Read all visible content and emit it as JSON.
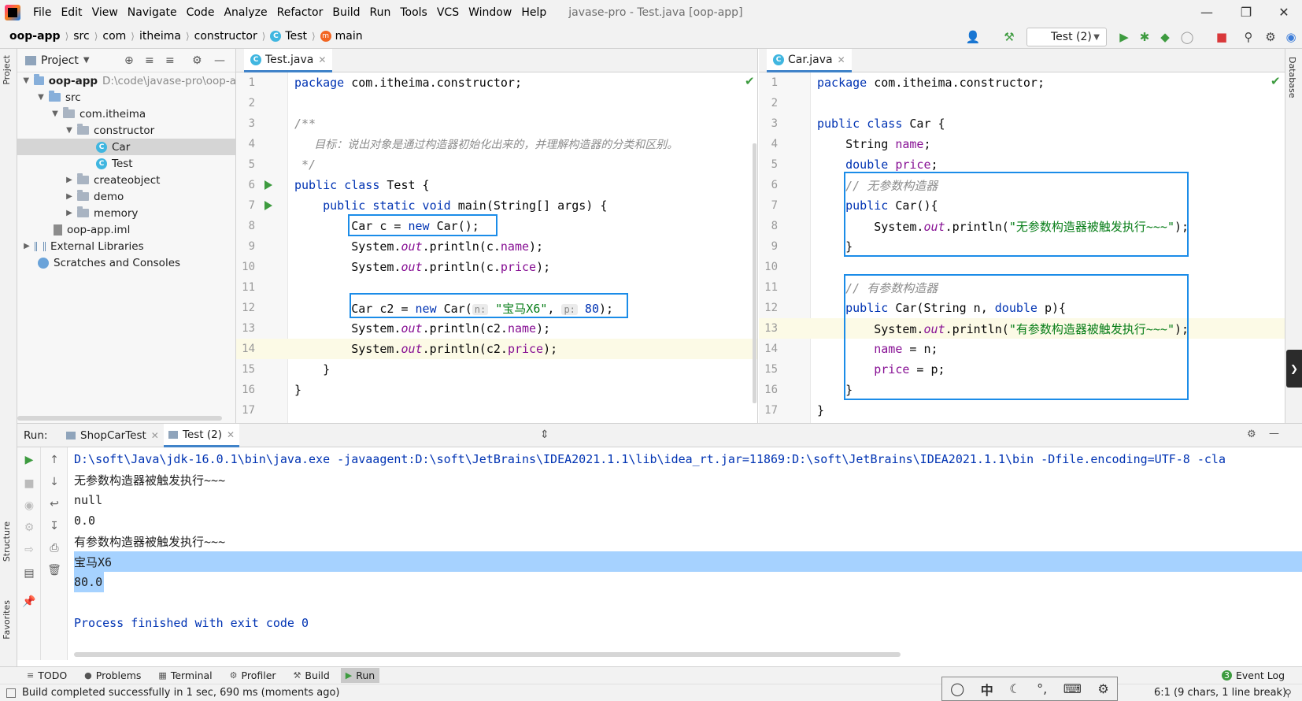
{
  "menubar": {
    "items": [
      "File",
      "Edit",
      "View",
      "Navigate",
      "Code",
      "Analyze",
      "Refactor",
      "Build",
      "Run",
      "Tools",
      "VCS",
      "Window",
      "Help"
    ],
    "window_title": "javase-pro - Test.java [oop-app]"
  },
  "navbar": {
    "crumbs": [
      "oop-app",
      "src",
      "com",
      "itheima",
      "constructor",
      "Test",
      "main"
    ],
    "run_config": "Test (2)"
  },
  "project": {
    "header": "Project",
    "tree": [
      {
        "label": "oop-app",
        "hint": "D:\\code\\javase-pro\\oop-a"
      },
      {
        "label": "src"
      },
      {
        "label": "com.itheima"
      },
      {
        "label": "constructor"
      },
      {
        "label": "Car"
      },
      {
        "label": "Test"
      },
      {
        "label": "createobject"
      },
      {
        "label": "demo"
      },
      {
        "label": "memory"
      },
      {
        "label": "oop-app.iml"
      },
      {
        "label": "External Libraries"
      },
      {
        "label": "Scratches and Consoles"
      }
    ]
  },
  "editor_left": {
    "tab": "Test.java",
    "lines": [
      {
        "n": "1"
      },
      {
        "n": "2"
      },
      {
        "n": "3"
      },
      {
        "n": "4"
      },
      {
        "n": "5"
      },
      {
        "n": "6"
      },
      {
        "n": "7"
      },
      {
        "n": "8"
      },
      {
        "n": "9"
      },
      {
        "n": "10"
      },
      {
        "n": "11"
      },
      {
        "n": "12"
      },
      {
        "n": "13"
      },
      {
        "n": "14"
      },
      {
        "n": "15"
      },
      {
        "n": "16"
      },
      {
        "n": "17"
      }
    ],
    "code": {
      "l1_kw": "package",
      "l1_rest": " com.itheima.constructor;",
      "l3": "/**",
      "l4": "   目标：说出对象是通过构造器初始化出来的，并理解构造器的分类和区别。",
      "l5": " */",
      "l6_kw": "public class",
      "l6_rest": " Test {",
      "l7_kw": "    public static void",
      "l7_rest": " main(String[] args) {",
      "l8_a": "        Car c = ",
      "l8_kw": "new",
      "l8_b": " Car();",
      "l9_a": "        System.",
      "l9_s": "out",
      "l9_b": ".println(c.",
      "l9_f": "name",
      "l9_c": ");",
      "l10_a": "        System.",
      "l10_s": "out",
      "l10_b": ".println(c.",
      "l10_f": "price",
      "l10_c": ");",
      "l12_a": "        Car c2 = ",
      "l12_kw": "new",
      "l12_b": " Car(",
      "l12_h1": "n:",
      "l12_str": " \"宝马X6\"",
      "l12_c": ", ",
      "l12_h2": "p:",
      "l12_num": " 80",
      "l12_d": ");",
      "l13_a": "        System.",
      "l13_s": "out",
      "l13_b": ".println(c2.",
      "l13_f": "name",
      "l13_c": ");",
      "l14_a": "        System.",
      "l14_s": "out",
      "l14_b": ".println(c2.",
      "l14_f": "price",
      "l14_c": ");",
      "l15": "    }",
      "l16": "}"
    }
  },
  "editor_right": {
    "tab": "Car.java",
    "code": {
      "l1_kw": "package",
      "l1_rest": " com.itheima.constructor;",
      "l3_kw": "public class",
      "l3_rest": " Car {",
      "l4_a": "    String ",
      "l4_f": "name",
      "l4_b": ";",
      "l5_kw": "    double ",
      "l5_f": "price",
      "l5_b": ";",
      "l6": "    // 无参数构造器",
      "l7_kw": "    public",
      "l7_rest": " Car(){",
      "l8_a": "        System.",
      "l8_s": "out",
      "l8_b": ".println(",
      "l8_str": "\"无参数构造器被触发执行~~~\"",
      "l8_c": ");",
      "l9": "    }",
      "l11": "    // 有参数构造器",
      "l12_kw": "    public",
      "l12_a": " Car(String n, ",
      "l12_kw2": "double",
      "l12_b": " p){",
      "l13_a": "        System.",
      "l13_s": "out",
      "l13_b": ".println(",
      "l13_str": "\"有参数构造器被触发执行~~~\"",
      "l13_c": ");",
      "l14_f": "        name",
      "l14_b": " = n;",
      "l15_f": "        price",
      "l15_b": " = p;",
      "l16": "    }",
      "l17": "}"
    }
  },
  "run": {
    "label": "Run:",
    "tabs": [
      "ShopCarTest",
      "Test (2)"
    ],
    "output": [
      "D:\\soft\\Java\\jdk-16.0.1\\bin\\java.exe -javaagent:D:\\soft\\JetBrains\\IDEA2021.1.1\\lib\\idea_rt.jar=11869:D:\\soft\\JetBrains\\IDEA2021.1.1\\bin -Dfile.encoding=UTF-8 -cla",
      "无参数构造器被触发执行~~~",
      "null",
      "0.0",
      "有参数构造器被触发执行~~~",
      "宝马X6",
      "80.0",
      "",
      "Process finished with exit code 0"
    ]
  },
  "bottom_tools": [
    "TODO",
    "Problems",
    "Terminal",
    "Profiler",
    "Build",
    "Run"
  ],
  "event_log": "Event Log",
  "status": {
    "message": "Build completed successfully in 1 sec, 690 ms (moments ago)",
    "position": "6:1 (9 chars, 1 line break)",
    "ime": "中"
  },
  "side_tabs": {
    "project": "Project",
    "structure": "Structure",
    "favorites": "Favorites",
    "database": "Database"
  },
  "colors": {
    "accent": "#4083c9",
    "annotation_box": "#1b8ce8",
    "selection": "#a6d2ff",
    "keyword": "#0033b3",
    "string": "#067d17",
    "field": "#871094"
  }
}
